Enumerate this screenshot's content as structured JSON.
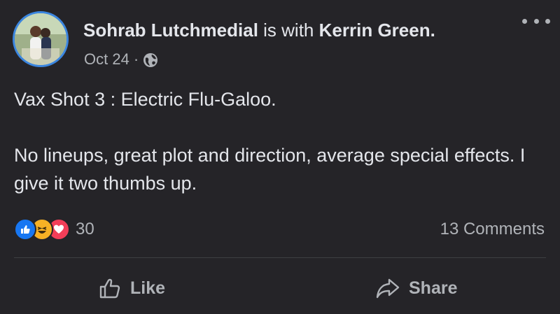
{
  "post": {
    "author": "Sohrab Lutchmedial",
    "with_text": "is with",
    "tagged": "Kerrin Green.",
    "date": "Oct 24",
    "separator": "·",
    "privacy_icon": "globe-icon",
    "body_line1": "Vax Shot 3 : Electric Flu-Galoo.",
    "body_line2": "No lineups, great plot and direction, average special effects. I give it two thumbs up.",
    "reactions": {
      "icons": [
        "like-icon",
        "haha-icon",
        "love-icon"
      ],
      "count": "30"
    },
    "comments_label": "13 Comments"
  },
  "actions": {
    "like_label": "Like",
    "share_label": "Share"
  },
  "colors": {
    "background": "#252428",
    "text": "#e4e6eb",
    "secondary_text": "#b0b3b8",
    "like_blue": "#1877f2",
    "haha_yellow": "#f7b125",
    "love_red": "#f33e58"
  }
}
